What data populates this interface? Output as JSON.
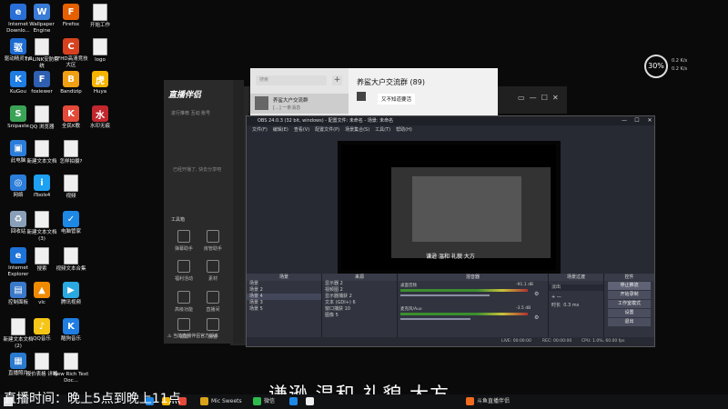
{
  "desktop_icons": [
    {
      "id": "ie-download",
      "label": "Internet Downlo...",
      "color": "#2a6fd6",
      "glyph": "e"
    },
    {
      "id": "wallpaper-engine",
      "label": "Wallpaper Engine",
      "color": "#3a7bd5",
      "glyph": "W"
    },
    {
      "id": "firefox",
      "label": "Firefox",
      "color": "#e66000",
      "glyph": "F"
    },
    {
      "id": "start-work",
      "label": "开始工作",
      "color": "#f0f0f0",
      "glyph": ""
    },
    {
      "id": "driver-7",
      "label": "驱动精灵7.0",
      "color": "#1d6bd1",
      "glyph": "驱"
    },
    {
      "id": "tplink",
      "label": "TP-LINK安防系统",
      "color": "#eeeeee",
      "glyph": ""
    },
    {
      "id": "cfhd",
      "label": "CFHD高清竞技大区",
      "color": "#d6421f",
      "glyph": "C"
    },
    {
      "id": "logo",
      "label": "logo",
      "color": "#f0f0f0",
      "glyph": ""
    },
    {
      "id": "kugou",
      "label": "KuGou",
      "color": "#1f7de3",
      "glyph": "K"
    },
    {
      "id": "foxiewer",
      "label": "foxiewer",
      "color": "#2f5fb0",
      "glyph": "F"
    },
    {
      "id": "bandizip",
      "label": "Bandizip",
      "color": "#f1a013",
      "glyph": "B"
    },
    {
      "id": "huya",
      "label": "Huya",
      "color": "#f5b400",
      "glyph": "虎"
    },
    {
      "id": "snipaste",
      "label": "Snipaste",
      "color": "#3aa356",
      "glyph": "S"
    },
    {
      "id": "qq-browser",
      "label": "QQ 浏览器",
      "color": "#eeeeee",
      "glyph": ""
    },
    {
      "id": "qiyu",
      "label": "全民K歌",
      "color": "#e34a3a",
      "glyph": "K"
    },
    {
      "id": "shuiwu",
      "label": "水印无痕",
      "color": "#c2272d",
      "glyph": "水"
    },
    {
      "id": "this-pc",
      "label": "此电脑",
      "color": "#2b7dd9",
      "glyph": "▣"
    },
    {
      "id": "new-text-1",
      "label": "新建文本文档",
      "color": "#f0f0f0",
      "glyph": ""
    },
    {
      "id": "how-to-shoot",
      "label": "怎样拍摄?",
      "color": "#f0f0f0",
      "glyph": ""
    },
    {
      "id": "network",
      "label": "网络",
      "color": "#2b7dd9",
      "glyph": "◎"
    },
    {
      "id": "itools",
      "label": "iTools4",
      "color": "#1da1f2",
      "glyph": "i"
    },
    {
      "id": "video",
      "label": "视频",
      "color": "#f0f0f0",
      "glyph": ""
    },
    {
      "id": "recycle-bin",
      "label": "回收站",
      "color": "#8aa0b8",
      "glyph": "♻"
    },
    {
      "id": "new-text-3",
      "label": "新建文本文档(3)",
      "color": "#f0f0f0",
      "glyph": ""
    },
    {
      "id": "pc-manager",
      "label": "电脑管家",
      "color": "#1e88e5",
      "glyph": "✓"
    },
    {
      "id": "ie",
      "label": "Internet Explorer",
      "color": "#1e73d8",
      "glyph": "e"
    },
    {
      "id": "search",
      "label": "搜索",
      "color": "#f0f0f0",
      "glyph": ""
    },
    {
      "id": "video-collection",
      "label": "视频文本合集",
      "color": "#f0f0f0",
      "glyph": ""
    },
    {
      "id": "control-panel",
      "label": "控制面板",
      "color": "#3a78c9",
      "glyph": "▤"
    },
    {
      "id": "vlc",
      "label": "vlc",
      "color": "#f08a00",
      "glyph": "▲"
    },
    {
      "id": "tencent-video",
      "label": "腾讯视频",
      "color": "#2aa8e0",
      "glyph": "▶"
    },
    {
      "id": "new-text-2",
      "label": "新建文本文档(2)",
      "color": "#f0f0f0",
      "glyph": ""
    },
    {
      "id": "qq-music",
      "label": "QQ音乐",
      "color": "#f5c518",
      "glyph": "♪"
    },
    {
      "id": "kugou-music",
      "label": "酷狗音乐",
      "color": "#1f7de3",
      "glyph": "K"
    },
    {
      "id": "live-video",
      "label": "直播照片",
      "color": "#2a7ad0",
      "glyph": "▦"
    },
    {
      "id": "prices",
      "label": "报价表格 详略",
      "color": "#f0f0f0",
      "glyph": ""
    },
    {
      "id": "new-rich-text",
      "label": "New Rich Text Doc...",
      "color": "#f0f0f0",
      "glyph": ""
    }
  ],
  "widget": {
    "value": "30%",
    "line1": "0.2 K/s",
    "line2": "0.2 K/s"
  },
  "chat": {
    "search_placeholder": "搜索",
    "plus": "+",
    "item_name": "养鲨大户交流群",
    "item_preview": "[...] 一条消息",
    "window_title": "养鲨大户交流群 (89)",
    "message": "又不知道要活"
  },
  "live_app": {
    "logo": "直播伴侣",
    "tabs": "进行推荐  互动  账号",
    "empty_text": "已经开播了, 快去分享吧",
    "tools_label": "工具箱",
    "tools": [
      {
        "label": "弹幕助手"
      },
      {
        "label": "房管助手"
      },
      {
        "label": "福利活动"
      },
      {
        "label": "素材"
      },
      {
        "label": "高级功能"
      },
      {
        "label": "直播间"
      },
      {
        "label": "特效"
      },
      {
        "label": "房管"
      }
    ],
    "footer": "⚠ 当前直播伴侣官方版本"
  },
  "obs": {
    "title": "OBS 24.0.3 (32 bit, windows) - 配置文件: 未命名 - 场景: 未命名",
    "menu": [
      "文件(F)",
      "编辑(E)",
      "查看(V)",
      "配置文件(P)",
      "场景集合(S)",
      "工具(T)",
      "帮助(H)"
    ],
    "preview_caption": "谦逊 温和 礼貌 大方",
    "scenes_header": "场景",
    "scenes": [
      "场景",
      "场景 2",
      "场景 4",
      "场景 3",
      "场景 5"
    ],
    "sources_header": "来源",
    "sources": [
      "显示器 2",
      "视频图 2",
      "显示器捕获 2",
      "文本 (GDI+) 6",
      "窗口捕获 10",
      "图像 5"
    ],
    "mixer_header": "混音器",
    "mixer": [
      {
        "label": "桌面音频",
        "value": "-91.1 dB",
        "level": 0.7
      },
      {
        "label": "麦克风/Aux",
        "value": "-3.5 dB",
        "level": 0.55
      }
    ],
    "transitions_header": "场景过渡",
    "transition": "淡出",
    "duration_label": "时长",
    "duration": "0.3 ms",
    "controls_header": "控件",
    "controls": [
      {
        "label": "停止推流",
        "active": true
      },
      {
        "label": "开始录制",
        "active": false
      },
      {
        "label": "工作室模式",
        "active": false
      },
      {
        "label": "设置",
        "active": false
      },
      {
        "label": "退出",
        "active": false
      }
    ],
    "status": {
      "live": "LIVE: 00:00:00",
      "rec": "REC: 00:00:00",
      "cpu": "CPU: 1.0%, 60.00 fps"
    }
  },
  "captions": {
    "subtitle": "谦逊 温和 礼貌 大方",
    "schedule": "直播时间：晚上5点到晚上11点"
  },
  "taskbar": [
    {
      "label": "",
      "color": "#1e88e5"
    },
    {
      "label": "",
      "color": "#f5b400"
    },
    {
      "label": "",
      "color": "#e34a3a"
    },
    {
      "label": "Mic Sweets",
      "color": "#d9a21a"
    },
    {
      "label": "微信",
      "color": "#2dbb4e"
    },
    {
      "label": "",
      "color": "#1e88e5"
    },
    {
      "label": "",
      "color": "#eeeeee"
    },
    {
      "label": "斗鱼直播伴侣",
      "color": "#f06a20"
    }
  ]
}
